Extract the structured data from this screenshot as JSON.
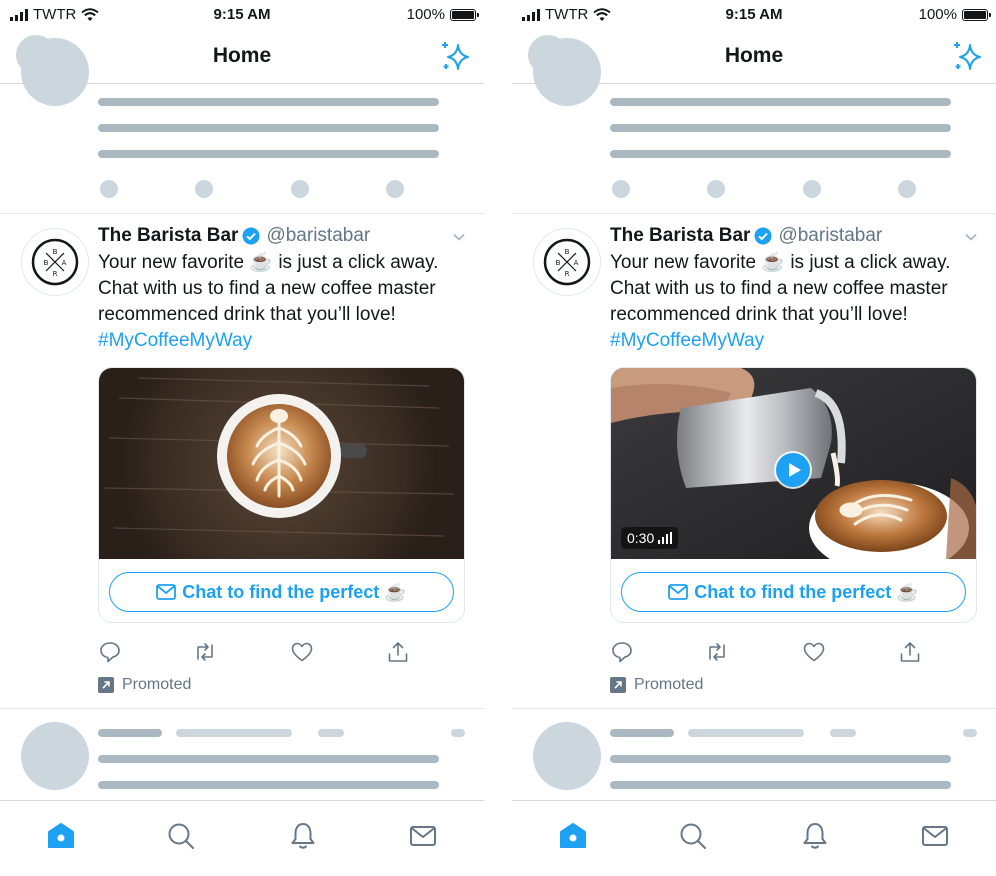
{
  "colors": {
    "accent": "#1da1f2",
    "skeleton_dark": "#aab8c2",
    "skeleton_light": "#ccd6dd",
    "secondary_text": "#657786"
  },
  "status_bar": {
    "carrier": "TWTR",
    "time": "9:15 AM",
    "battery": "100%",
    "battery_level": 1.0
  },
  "header": {
    "title": "Home",
    "avatar_icon": "avatar-placeholder",
    "right_icon": "sparkle-icon"
  },
  "tweet": {
    "name": "The Barista Bar",
    "handle": "@baristabar",
    "verified": true,
    "text_line_1": "Your new favorite ☕ is just a click away.",
    "text_line_2": "Chat with us to find a new coffee master",
    "text_line_3": "recommenced drink that you’ll love!",
    "hashtag": "#MyCoffeeMyWay",
    "logo_letters": [
      "B",
      "B",
      "A",
      "R"
    ],
    "cta_label": "Chat to find the perfect ☕",
    "cta_icon": "envelope-icon",
    "promoted_label": "Promoted",
    "actions": [
      "reply-icon",
      "retweet-icon",
      "like-icon",
      "share-icon"
    ]
  },
  "phones": [
    {
      "media_type": "image",
      "media_description_icon": "latte-art-photo"
    },
    {
      "media_type": "video",
      "video_duration": "0:30",
      "media_description_icon": "milk-pour-video"
    }
  ],
  "tabbar": {
    "items": [
      "home-icon",
      "search-icon",
      "notifications-icon",
      "messages-icon"
    ],
    "active": "home-icon"
  }
}
